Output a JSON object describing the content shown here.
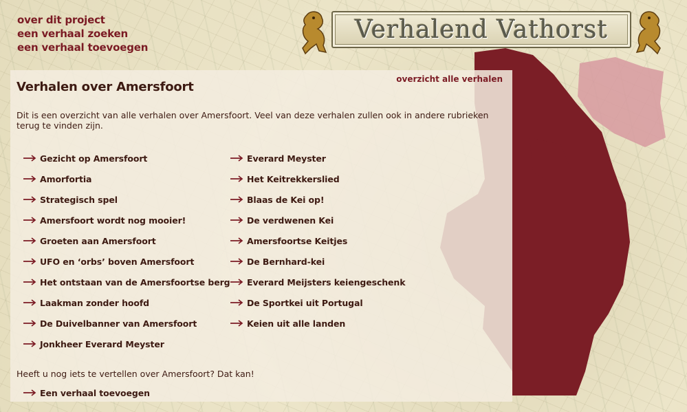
{
  "header": {
    "site_title": "Verhalend Vathorst",
    "nav": [
      {
        "label": "over dit project"
      },
      {
        "label": "een verhaal zoeken"
      },
      {
        "label": "een verhaal toevoegen"
      }
    ]
  },
  "content": {
    "title": "Verhalen over Amersfoort",
    "overview_link": "overzicht alle verhalen",
    "intro": "Dit is een overzicht van alle verhalen over Amersfoort. Veel van deze verhalen zullen ook in andere rubrieken terug te vinden zijn.",
    "stories_left": [
      "Gezicht op Amersfoort",
      "Amorfortia",
      "Strategisch spel",
      "Amersfoort wordt nog mooier!",
      "Groeten aan Amersfoort",
      "UFO en ‘orbs’ boven Amersfoort",
      "Het ontstaan van de Amersfoortse berg",
      "Laakman zonder hoofd",
      "De Duivelbanner van Amersfoort",
      "Jonkheer Everard Meyster"
    ],
    "stories_right": [
      "Everard Meyster",
      "Het Keitrekkerslied",
      "Blaas de Kei op!",
      "De verdwenen Kei",
      "Amersfoortse Keitjes",
      "De Bernhard-kei",
      "Everard Meijsters keiengeschenk",
      "De Sportkei uit Portugal",
      "Keien uit alle landen"
    ],
    "closing_text": "Heeft u nog iets te vertellen over Amersfoort? Dat kan!",
    "add_story_link": "Een verhaal toevoegen"
  },
  "colors": {
    "accent": "#7b1b24",
    "text": "#3d1a12",
    "map_region": "#7b1e26",
    "map_region_light": "#d79aa0"
  },
  "icons": {
    "link_arrow": "arrow-right-icon",
    "heraldic_lion": "lion-icon"
  }
}
